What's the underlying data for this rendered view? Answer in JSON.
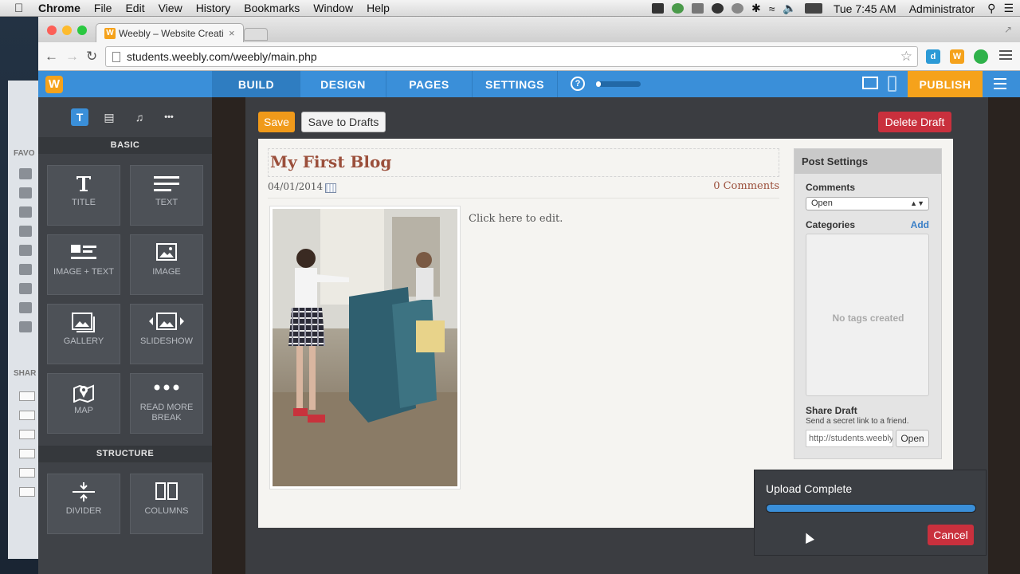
{
  "menubar": {
    "apple": "",
    "app_name": "Chrome",
    "menus": [
      "File",
      "Edit",
      "View",
      "History",
      "Bookmarks",
      "Window",
      "Help"
    ],
    "clock": "Tue 7:45 AM",
    "user": "Administrator"
  },
  "browser": {
    "tab_title": "Weebly – Website Creation",
    "tab_close": "×",
    "favicon": "W",
    "url": "students.weebly.com/weebly/main.php",
    "extensions": [
      "d",
      "W",
      ""
    ]
  },
  "weebly_nav": {
    "logo": "W",
    "tabs": [
      "BUILD",
      "DESIGN",
      "PAGES",
      "SETTINGS"
    ],
    "active_tab": "BUILD",
    "help": "?",
    "progress_fraction": 0.1,
    "publish": "PUBLISH"
  },
  "panel": {
    "tab_icons": [
      "T",
      "▤",
      "♫",
      "•••"
    ],
    "basic_header": "BASIC",
    "basic_items": [
      "TITLE",
      "TEXT",
      "IMAGE + TEXT",
      "IMAGE",
      "GALLERY",
      "SLIDESHOW",
      "MAP",
      "READ MORE BREAK"
    ],
    "structure_header": "STRUCTURE",
    "structure_items": [
      "DIVIDER",
      "COLUMNS"
    ]
  },
  "editor": {
    "save": "Save",
    "save_drafts": "Save to Drafts",
    "delete_draft": "Delete Draft",
    "post_title": "My First Blog",
    "post_date": "04/01/2014",
    "comments_link": "0 Comments",
    "body_placeholder": "Click here to edit."
  },
  "post_settings": {
    "header": "Post Settings",
    "comments_label": "Comments",
    "comments_value": "Open",
    "categories_label": "Categories",
    "add": "Add",
    "tags_empty": "No tags created",
    "share_label": "Share Draft",
    "share_sub": "Send a secret link to a friend.",
    "share_url": "http://students.weebly.com",
    "share_open": "Open"
  },
  "upload": {
    "title": "Upload Complete",
    "progress_fraction": 1.0,
    "cancel": "Cancel"
  },
  "colors": {
    "weebly_blue": "#3a8fd9",
    "publish_orange": "#f5a21b",
    "danger_red": "#c9303d",
    "title_brown": "#9b4f3b"
  }
}
